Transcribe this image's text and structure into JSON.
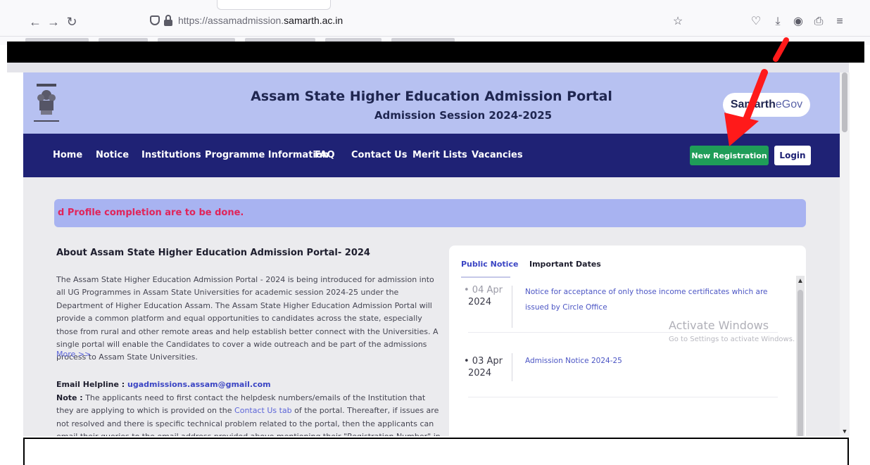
{
  "browser": {
    "url_prefix": "https://assamadmission.",
    "url_domain": "samarth.ac.in"
  },
  "header": {
    "title": "Assam State Higher Education Admission Portal",
    "session": "Admission Session 2024-2025",
    "logo_part1": "Samarth",
    "logo_part2": "eGov"
  },
  "nav": {
    "items": [
      "Home",
      "Notice",
      "Institutions",
      "Programme Information",
      "FAQ",
      "Contact Us",
      "Merit Lists",
      "Vacancies"
    ],
    "register_label": "New Registration",
    "login_label": "Login"
  },
  "alert": {
    "text": "d Profile completion are to be done."
  },
  "about": {
    "title": "About Assam State Higher Education Admission Portal- 2024",
    "body": "The Assam State Higher Education Admission Portal - 2024 is being introduced for admission into all UG Programmes in Assam State Universities for academic session 2024-25 under the Department of Higher Education Assam. The Assam State Higher Education Admission Portal will provide a common platform and equal opportunities to candidates across the state, especially those from rural and other remote areas and help establish better connect with the Universities. A single portal will enable the Candidates to cover a wide outreach and be part of the admissions process to Assam State Universities.",
    "more": "More >>",
    "helpline_label": "Email Helpline : ",
    "helpline_email": "ugadmissions.assam@gmail.com",
    "note_label": "Note :",
    "note_part1": " The applicants need to first contact the helpdesk numbers/emails of the Institution that they are applying to which is provided on the ",
    "note_link": "Contact Us tab",
    "note_part2": " of the portal. Thereafter, if issues are not resolved and there is specific technical problem related to the portal, then the applicants can email their queries to the email address provided above mentioning their \"Registration Number\" in email Subject Line and with their"
  },
  "notices": {
    "tab_public": "Public Notice",
    "tab_dates": "Important Dates",
    "items": [
      {
        "date_line1": "• 04 Apr",
        "date_line2": "2024",
        "text": "Notice for acceptance of only those income certificates which are issued by Circle Office"
      },
      {
        "date_line1": "• 03 Apr",
        "date_line2": "2024",
        "text": "Admission Notice 2024-25"
      }
    ]
  },
  "watermark": {
    "title": "Activate Windows",
    "subtitle": "Go to Settings to activate Windows."
  },
  "colors": {
    "header_bg": "#b7c1f1",
    "nav_bg": "#1f2275",
    "register_bg": "#1f9d58",
    "alert_text": "#e0245a",
    "annotation_arrow": "#ff1a1a"
  }
}
